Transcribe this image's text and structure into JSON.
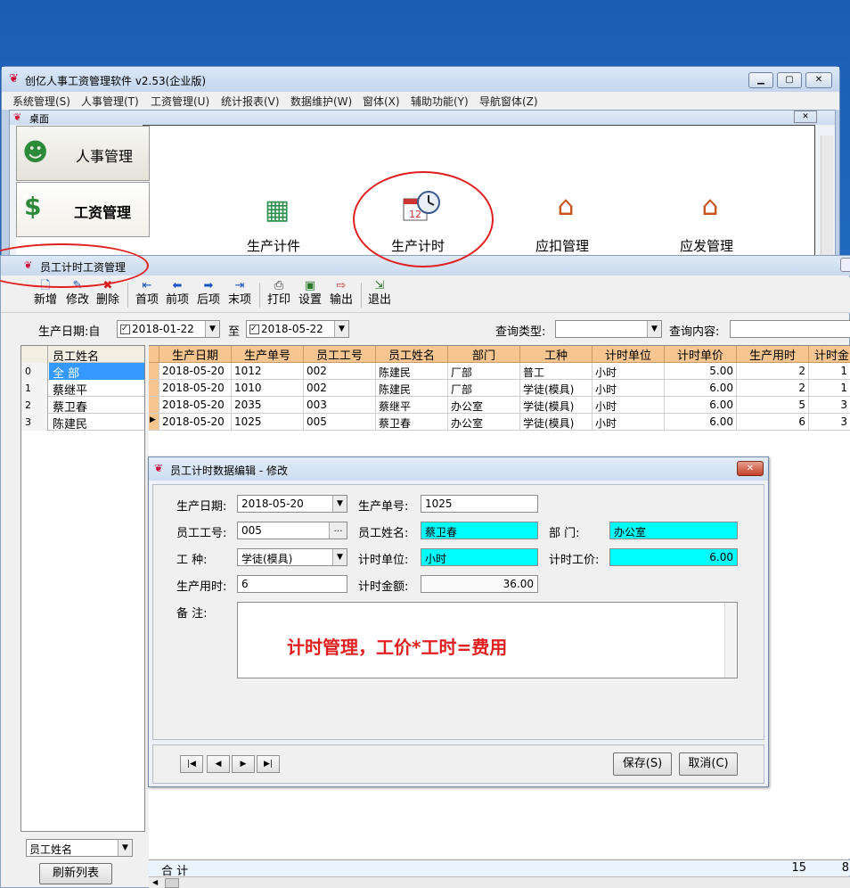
{
  "app": {
    "title": "创亿人事工资管理软件 v2.53(企业版)",
    "menu": [
      "系统管理(S)",
      "人事管理(T)",
      "工资管理(U)",
      "统计报表(V)",
      "数据维护(W)",
      "窗体(X)",
      "辅助功能(Y)",
      "导航窗体(Z)"
    ],
    "desktop_title": "桌面",
    "nav": [
      "人事管理",
      "工资管理"
    ],
    "modules": [
      "生产计件",
      "生产计时",
      "应扣管理",
      "应发管理"
    ]
  },
  "child": {
    "title": "员工计时工资管理",
    "toolbar": [
      {
        "label": "新增",
        "icon": "new-icon"
      },
      {
        "label": "修改",
        "icon": "edit-icon"
      },
      {
        "label": "删除",
        "icon": "delete-icon"
      },
      {
        "label": "首项",
        "icon": "first-icon"
      },
      {
        "label": "前项",
        "icon": "prev-icon"
      },
      {
        "label": "后项",
        "icon": "next-icon"
      },
      {
        "label": "末项",
        "icon": "last-icon"
      },
      {
        "label": "打印",
        "icon": "print-icon"
      },
      {
        "label": "设置",
        "icon": "settings-icon"
      },
      {
        "label": "输出",
        "icon": "export-icon"
      },
      {
        "label": "退出",
        "icon": "exit-icon"
      }
    ],
    "filter": {
      "date_label": "生产日期:自",
      "date_from": "2018-01-22",
      "to_label": "至",
      "date_to": "2018-05-22",
      "query_type_label": "查询类型:",
      "query_type": "",
      "query_content_label": "查询内容:",
      "query_content": ""
    },
    "names": {
      "header": "员工姓名",
      "rows": [
        {
          "idx": "0",
          "name": "全  部"
        },
        {
          "idx": "1",
          "name": "蔡继平"
        },
        {
          "idx": "2",
          "name": "蔡卫春"
        },
        {
          "idx": "3",
          "name": "陈建民"
        }
      ],
      "sort_field": "员工姓名",
      "refresh": "刷新列表"
    },
    "grid": {
      "headers": [
        "生产日期",
        "生产单号",
        "员工工号",
        "员工姓名",
        "部门",
        "工种",
        "计时单位",
        "计时单价",
        "生产用时",
        "计时金"
      ],
      "rows": [
        [
          "2018-05-20",
          "1012",
          "002",
          "陈建民",
          "厂部",
          "普工",
          "小时",
          "5.00",
          "2",
          "1"
        ],
        [
          "2018-05-20",
          "1010",
          "002",
          "陈建民",
          "厂部",
          "学徒(模具)",
          "小时",
          "6.00",
          "2",
          "1"
        ],
        [
          "2018-05-20",
          "2035",
          "003",
          "蔡继平",
          "办公室",
          "学徒(模具)",
          "小时",
          "6.00",
          "5",
          "3"
        ],
        [
          "2018-05-20",
          "1025",
          "005",
          "蔡卫春",
          "办公室",
          "学徒(模具)",
          "小时",
          "6.00",
          "6",
          "3"
        ]
      ],
      "total_label": "合  计",
      "total_hours": "15",
      "total_amount": "8"
    }
  },
  "dialog": {
    "title": "员工计时数据编辑 - 修改",
    "date_label": "生产日期:",
    "date": "2018-05-20",
    "order_label": "生产单号:",
    "order": "1025",
    "emp_id_label": "员工工号:",
    "emp_id": "005",
    "emp_name_label": "员工姓名:",
    "emp_name": "蔡卫春",
    "dept_label": "部    门:",
    "dept": "办公室",
    "job_label": "工    种:",
    "job": "学徒(模具)",
    "unit_label": "计时单位:",
    "unit": "小时",
    "price_label": "计时工价:",
    "price": "6.00",
    "hours_label": "生产用时:",
    "hours": "6",
    "amount_label": "计时金额:",
    "amount": "36.00",
    "remark_label": "备    注:",
    "annotation": "计时管理，工价*工时=费用",
    "save": "保存(S)",
    "cancel": "取消(C)"
  },
  "colors": {
    "accent_red": "#e02020",
    "header_orange": "#f7c690",
    "cyan": "#00ffff",
    "selection": "#3399ff"
  }
}
